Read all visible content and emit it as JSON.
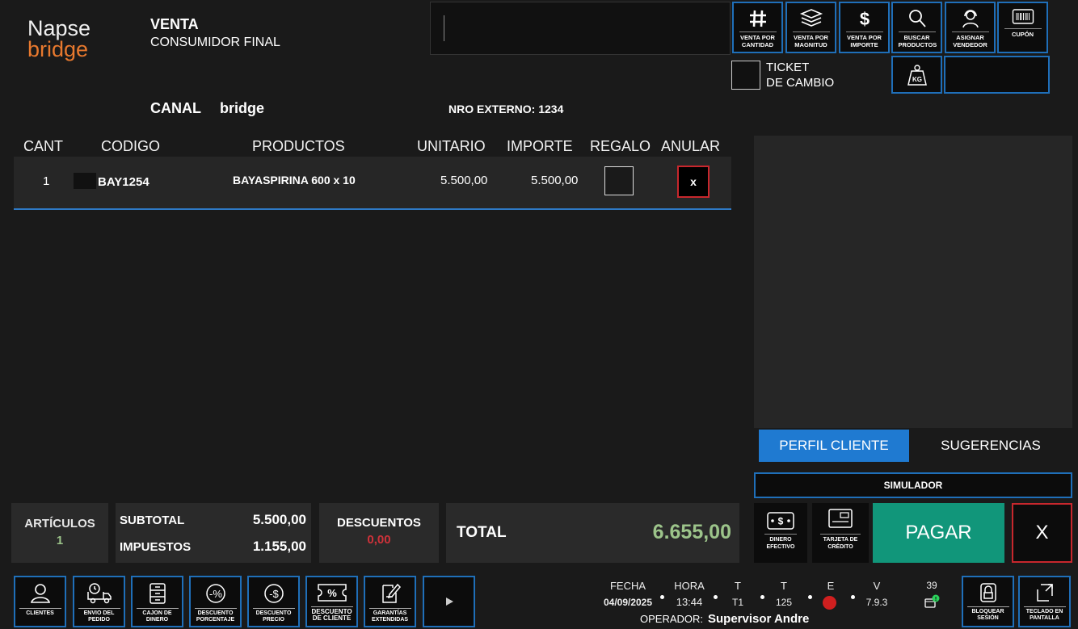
{
  "logo": {
    "line1": "Napse",
    "line2": "bridge"
  },
  "header": {
    "mode": "VENTA",
    "customer": "CONSUMIDOR FINAL",
    "canal_label": "CANAL",
    "canal_value": "bridge",
    "nro_externo": "NRO EXTERNO: 1234"
  },
  "search": {
    "placeholder": ""
  },
  "top_buttons": [
    {
      "label": "VENTA POR CANTIDAD",
      "icon": "hash-icon"
    },
    {
      "label": "VENTA POR MAGNITUD",
      "icon": "layers-icon"
    },
    {
      "label": "VENTA POR IMPORTE",
      "icon": "dollar-icon"
    },
    {
      "label": "BUSCAR PRODUCTOS",
      "icon": "search-icon"
    },
    {
      "label": "ASIGNAR VENDEDOR",
      "icon": "headset-icon"
    },
    {
      "label": "CUPÓN",
      "icon": "barcode-icon"
    }
  ],
  "ticket_cambio": {
    "line1": "TICKET",
    "line2": "DE CAMBIO"
  },
  "weight_icon_text": "KG",
  "columns": {
    "cant": "CANT",
    "codigo": "CODIGO",
    "productos": "PRODUCTOS",
    "unitario": "UNITARIO",
    "importe": "IMPORTE",
    "regalo": "REGALO",
    "anular": "ANULAR"
  },
  "items": [
    {
      "cant": "1",
      "codigo": "BAY1254",
      "producto": "BAYASPIRINA 600 x 10",
      "unitario": "5.500,00",
      "importe": "5.500,00",
      "anular": "x"
    }
  ],
  "tabs": {
    "perfil": "PERFIL CLIENTE",
    "sugerencias": "SUGERENCIAS"
  },
  "simulador": "SIMULADOR",
  "totals": {
    "articulos_label": "ARTÍCULOS",
    "articulos_value": "1",
    "subtotal_label": "SUBTOTAL",
    "subtotal_value": "5.500,00",
    "impuestos_label": "IMPUESTOS",
    "impuestos_value": "1.155,00",
    "descuentos_label": "DESCUENTOS",
    "descuentos_value": "0,00",
    "total_label": "TOTAL",
    "total_value": "6.655,00"
  },
  "payment": {
    "efectivo": "DINERO EFECTIVO",
    "tarjeta": "TARJETA DE CRÉDITO",
    "pagar": "PAGAR",
    "cancel": "X"
  },
  "bottom_buttons": [
    {
      "label": "CLIENTES",
      "icon": "user-icon"
    },
    {
      "label": "ENVIO DEL PEDIDO",
      "icon": "truck-icon"
    },
    {
      "label": "CAJON DE DINERO",
      "icon": "drawer-icon"
    },
    {
      "label": "DESCUENTO PORCENTAJE",
      "icon": "percent-icon"
    },
    {
      "label": "DESCUENTO PRECIO",
      "icon": "dollar-circle-icon"
    },
    {
      "label": "DESCUENTO DE CLIENTE",
      "icon": "percent-ticket-icon"
    },
    {
      "label": "GARANTÍAS EXTENDIDAS",
      "icon": "document-pen-icon"
    }
  ],
  "status": {
    "fecha_label": "FECHA",
    "fecha_value": "04/09/2025",
    "hora_label": "HORA",
    "hora_value": "13:44",
    "t1_label": "T",
    "t1_value": "T1",
    "t2_label": "T",
    "t2_value": "125",
    "e_label": "E",
    "v_label": "V",
    "v_value": "7.9.3",
    "notif_count": "39",
    "operador_label": "OPERADOR:",
    "operador_value": "Supervisor Andre"
  },
  "bloquear": "BLOQUEAR SESIÓN",
  "teclado": "TECLADO EN PANTALLA",
  "colors": {
    "accent_blue": "#1f6fb9",
    "pagar_green": "#11967a",
    "total_green": "#9cc48a",
    "cancel_red": "#c8272d",
    "descuento_red": "#d0323a"
  }
}
